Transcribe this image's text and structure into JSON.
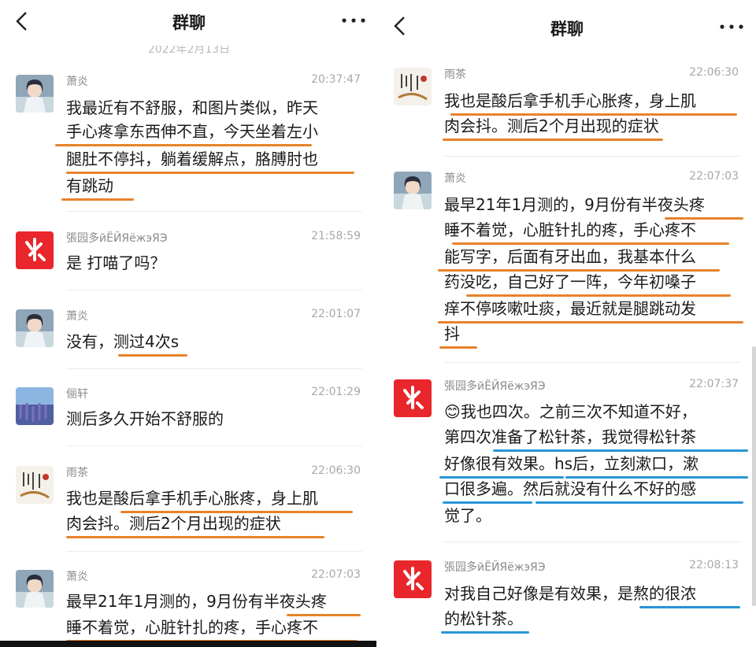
{
  "navbar": {
    "title": "群聊"
  },
  "date_separator": "2022年2月13日",
  "left_messages": [
    {
      "sender": "萧炎",
      "time": "20:37:47",
      "lines": [
        "我最近有不舒服，和图片类似，昨天",
        "手心疼拿东西伸不直，今天坐着左小",
        "腿肚不停抖，躺着缓解点，胳膊肘也",
        "有跳动"
      ]
    },
    {
      "sender": "張园多йЁЙЯёжэЯЭ",
      "time": "21:58:59",
      "lines": [
        "是 打喵了吗？"
      ]
    },
    {
      "sender": "萧炎",
      "time": "22:01:07",
      "lines": [
        "没有，测过4次s"
      ]
    },
    {
      "sender": "俪轩",
      "time": "22:01:29",
      "lines": [
        "测后多久开始不舒服的"
      ]
    },
    {
      "sender": "雨茶",
      "time": "22:06:30",
      "lines": [
        "我也是酸后拿手机手心胀疼，身上肌",
        "肉会抖。测后2个月出现的症状"
      ]
    },
    {
      "sender": "萧炎",
      "time": "22:07:03",
      "lines": [
        "最早21年1月测的，9月份有半夜头疼",
        "睡不着觉，心脏针扎的疼，手心疼不"
      ]
    }
  ],
  "right_messages": [
    {
      "sender": "雨茶",
      "time": "22:06:30",
      "lines": [
        "我也是酸后拿手机手心胀疼，身上肌",
        "肉会抖。测后2个月出现的症状"
      ]
    },
    {
      "sender": "萧炎",
      "time": "22:07:03",
      "lines": [
        "最早21年1月测的，9月份有半夜头疼",
        "睡不着觉，心脏针扎的疼，手心疼不",
        "能写字，后面有牙出血，我基本什么",
        "药没吃，自己好了一阵，今年初嗓子",
        "痒不停咳嗽吐痰，最近就是腿跳动发",
        "抖"
      ]
    },
    {
      "sender": "張园多йЁЙЯёжэЯЭ",
      "time": "22:07:37",
      "lines": [
        "😊我也四次。之前三次不知道不好，",
        "第四次准备了松针茶，我觉得松针茶",
        "好像很有效果。hs后，立刻漱口，漱",
        "口很多遍。然后就没有什么不好的感",
        "觉了。"
      ]
    },
    {
      "sender": "張园多йЁЙЯёжэЯЭ",
      "time": "22:08:13",
      "lines": [
        "对我自己好像是有效果，是熬的很浓",
        "的松针茶。"
      ]
    }
  ],
  "colors": {
    "underline_orange": "#e8822a",
    "underline_blue": "#2a95d6",
    "logo_red": "#e8262b"
  },
  "icons": [
    "back-chevron-icon",
    "more-dots-icon"
  ]
}
